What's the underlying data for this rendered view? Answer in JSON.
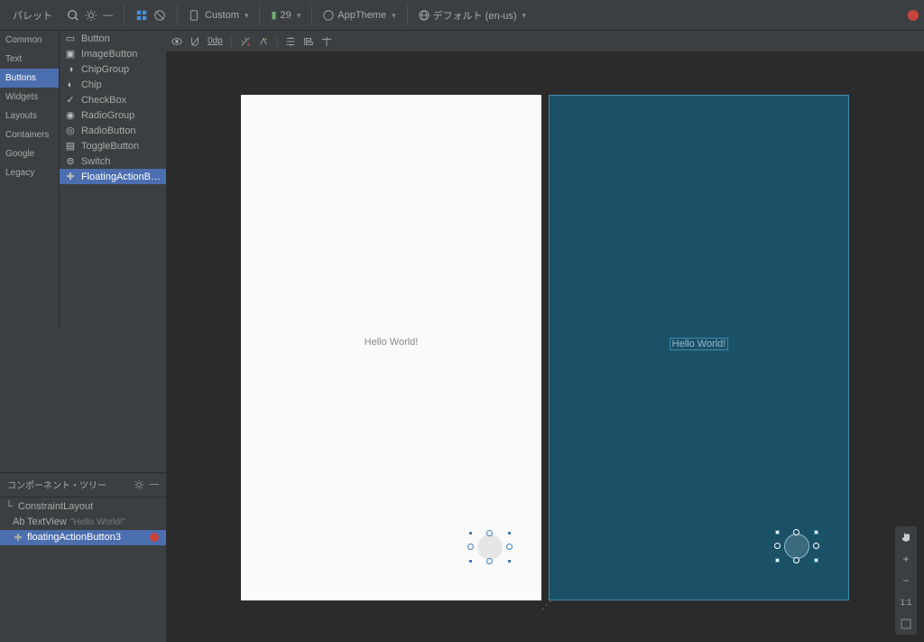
{
  "palette": {
    "title": "パレット",
    "categories": [
      "Common",
      "Text",
      "Buttons",
      "Widgets",
      "Layouts",
      "Containers",
      "Google",
      "Legacy"
    ],
    "selectedCategory": "Buttons",
    "items": [
      {
        "icon": "button-icon",
        "label": "Button"
      },
      {
        "icon": "image-button-icon",
        "label": "ImageButton"
      },
      {
        "icon": "chip-group-icon",
        "label": "ChipGroup"
      },
      {
        "icon": "chip-icon",
        "label": "Chip"
      },
      {
        "icon": "checkbox-icon",
        "label": "CheckBox"
      },
      {
        "icon": "radio-group-icon",
        "label": "RadioGroup"
      },
      {
        "icon": "radio-button-icon",
        "label": "RadioButton"
      },
      {
        "icon": "toggle-button-icon",
        "label": "ToggleButton"
      },
      {
        "icon": "switch-icon",
        "label": "Switch"
      },
      {
        "icon": "fab-icon",
        "label": "FloatingActionB…"
      }
    ],
    "selectedItemIndex": 9
  },
  "tree": {
    "title": "コンポーネント・ツリー",
    "nodes": [
      {
        "icon": "layout-icon",
        "label": "ConstraintLayout",
        "indent": 0
      },
      {
        "icon": "text-icon",
        "label": "TextView",
        "hint": "\"Hello World!\"",
        "indent": 1
      },
      {
        "icon": "fab-icon",
        "label": "floatingActionButton3",
        "indent": 1,
        "error": true,
        "selected": true
      }
    ]
  },
  "toolbar": {
    "device": "Custom",
    "api": "29",
    "theme": "AppTheme",
    "locale": "デフォルト (en-us)"
  },
  "designToolbar": {
    "dpLabel": "0dp"
  },
  "canvas": {
    "helloText": "Hello World!"
  },
  "zoom": {
    "oneToOne": "1:1",
    "plus": "+",
    "minus": "−"
  }
}
